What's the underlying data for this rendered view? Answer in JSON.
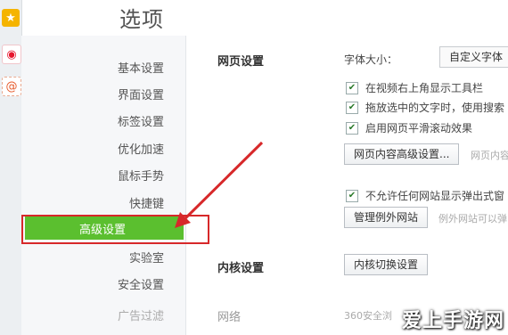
{
  "app": {
    "title": "选项"
  },
  "appbar": {
    "icons": [
      "star-icon",
      "weibo-icon",
      "at-mail-icon"
    ]
  },
  "sidebar": {
    "items": [
      {
        "label": "基本设置"
      },
      {
        "label": "界面设置"
      },
      {
        "label": "标签设置"
      },
      {
        "label": "优化加速"
      },
      {
        "label": "鼠标手势"
      },
      {
        "label": "快捷键"
      },
      {
        "label": "高级设置",
        "active": true
      },
      {
        "label": "实验室"
      },
      {
        "label": "安全设置"
      },
      {
        "label": "广告过滤"
      }
    ]
  },
  "web_settings": {
    "heading": "网页设置",
    "font_size_label": "字体大小：",
    "font_select_value": "自定义字体",
    "checkboxes": [
      {
        "label": "在视频右上角显示工具栏",
        "checked": true
      },
      {
        "label": "拖放选中的文字时，使用搜索",
        "checked": true
      },
      {
        "label": "启用网页平滑滚动效果",
        "checked": true
      }
    ],
    "advanced_button": "网页内容高级设置...",
    "advanced_hint": "网页内容",
    "popup_checkbox": {
      "label": "不允许任何网站显示弹出式窗",
      "checked": true
    },
    "exceptions_button": "管理例外网站",
    "exceptions_hint": "例外网站可以弹"
  },
  "kernel_settings": {
    "heading": "内核设置",
    "button": "内核切换设置"
  },
  "network": {
    "heading": "网络",
    "hint": "360安全浏"
  },
  "watermark": "爱上手游网",
  "colors": {
    "active_green": "#5bbf2f",
    "annotation_red": "#d7282a"
  }
}
